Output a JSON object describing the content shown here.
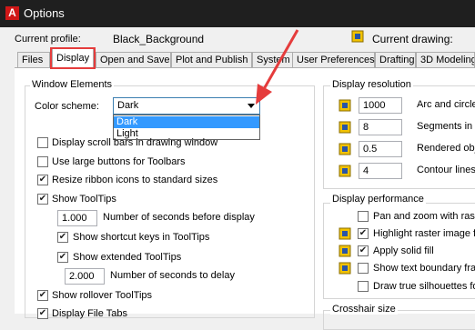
{
  "window": {
    "title": "Options",
    "app_icon": "A"
  },
  "profile": {
    "current_profile_label": "Current profile:",
    "current_profile_value": "Black_Background",
    "current_drawing_label": "Current drawing:"
  },
  "tabs": [
    {
      "label": "Files"
    },
    {
      "label": "Display",
      "active": true
    },
    {
      "label": "Open and Save"
    },
    {
      "label": "Plot and Publish"
    },
    {
      "label": "System"
    },
    {
      "label": "User Preferences"
    },
    {
      "label": "Drafting"
    },
    {
      "label": "3D Modeling"
    }
  ],
  "window_elements": {
    "title": "Window Elements",
    "color_scheme_label": "Color scheme:",
    "color_scheme_value": "Dark",
    "color_scheme_options": [
      "Dark",
      "Light"
    ],
    "checks": [
      {
        "label": "Display scroll bars in drawing window",
        "checked": false
      },
      {
        "label": "Use large buttons for Toolbars",
        "checked": false
      },
      {
        "label": "Resize ribbon icons to standard sizes",
        "checked": true
      },
      {
        "label": "Show ToolTips",
        "checked": true
      }
    ],
    "tooltip_delay_value": "1.000",
    "tooltip_delay_label": "Number of seconds before display",
    "sub_checks": [
      {
        "label": "Show shortcut keys in ToolTips",
        "checked": true
      },
      {
        "label": "Show extended ToolTips",
        "checked": true
      }
    ],
    "extended_delay_value": "2.000",
    "extended_delay_label": "Number of seconds to delay",
    "rollover_label": "Show rollover ToolTips",
    "file_tabs_label": "Display File Tabs"
  },
  "display_resolution": {
    "title": "Display resolution",
    "rows": [
      {
        "value": "1000",
        "label": "Arc and circle"
      },
      {
        "value": "8",
        "label": "Segments in a"
      },
      {
        "value": "0.5",
        "label": "Rendered obj"
      },
      {
        "value": "4",
        "label": "Contour lines p"
      }
    ]
  },
  "display_performance": {
    "title": "Display performance",
    "rows": [
      {
        "label": "Pan and zoom with raste",
        "checked": false
      },
      {
        "label": "Highlight raster image fra",
        "checked": true
      },
      {
        "label": "Apply solid fill",
        "checked": true
      },
      {
        "label": "Show text boundary fran",
        "checked": false
      },
      {
        "label": "Draw true silhouettes fo",
        "checked": false
      }
    ]
  },
  "crosshair": {
    "title": "Crosshair size"
  },
  "colors": {
    "annotation": "#e53c3c",
    "selection": "#3399ff",
    "titlebar": "#1f1f1f"
  }
}
